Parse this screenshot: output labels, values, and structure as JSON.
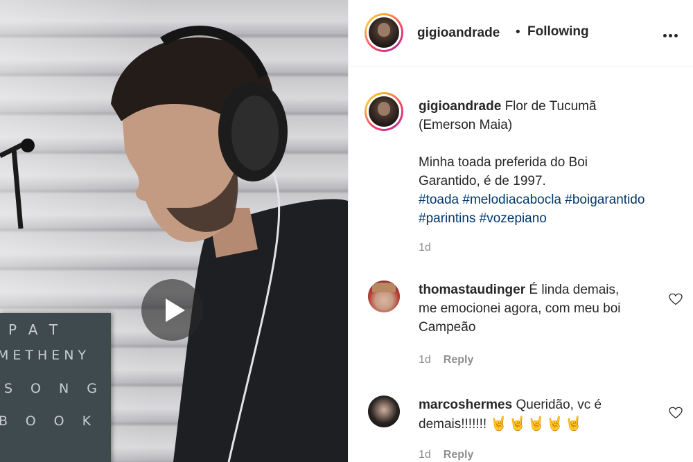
{
  "header": {
    "username": "gigioandrade",
    "separator": "•",
    "follow_status": "Following",
    "more_label": "•••"
  },
  "media": {
    "type": "video",
    "book_lines": [
      "PAT",
      "METHENY",
      "SONG",
      "BOOK"
    ]
  },
  "caption": {
    "username": "gigioandrade",
    "title_line1": "Flor de Tucumã",
    "title_line2": "(Emerson Maia)",
    "body_line1": "Minha toada preferida do Boi",
    "body_line2": "Garantido, é de 1997.",
    "hashtags_line1": [
      "#toada",
      "#melodiacabocla",
      "#boigarantido"
    ],
    "hashtags_line2": [
      "#parintins",
      "#vozepiano"
    ],
    "time": "1d"
  },
  "comments": [
    {
      "username": "thomastaudinger",
      "text_line1": "É linda demais,",
      "text_line2": "me emocionei agora, com meu boi",
      "text_line3": "Campeão",
      "time": "1d",
      "reply_label": "Reply"
    },
    {
      "username": "marcoshermes",
      "text_line1": "Queridão, vc é",
      "text_line2": "demais!!!!!!!",
      "emoji": [
        "🤘",
        "🤘",
        "🤘",
        "🤘",
        "🤘"
      ],
      "time": "1d",
      "reply_label": "Reply"
    }
  ],
  "colors": {
    "text": "#262626",
    "muted": "#8e8e8e",
    "hashtag": "#00376b",
    "play_overlay": "#282828"
  },
  "icons": [
    "play-icon",
    "more-options-icon",
    "heart-icon"
  ]
}
